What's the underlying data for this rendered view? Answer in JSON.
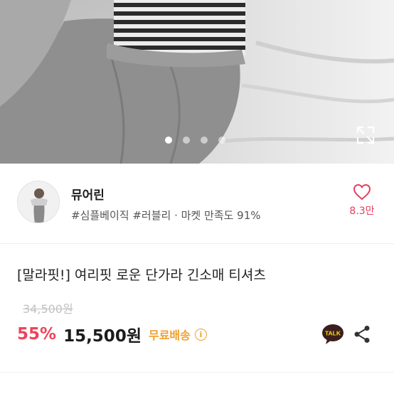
{
  "carousel": {
    "slide_count": 4,
    "active_index": 0
  },
  "shop": {
    "name": "뮤어린",
    "meta": "#심플베이직 #러블리 · 마켓 만족도 91%",
    "like_count": "8.3만"
  },
  "product": {
    "title": "[말라핏!] 여리핏 로운 단가라 긴소매 티셔츠",
    "original_price": "34,500원",
    "discount_rate": "55%",
    "price": "15,500원",
    "shipping_label": "무료배송",
    "info_icon_glyph": "i"
  },
  "icons": {
    "talk_label": "TALK",
    "expand": "expand-icon",
    "heart": "heart-icon",
    "share": "share-icon"
  },
  "colors": {
    "discount": "#f0435a",
    "like": "#e4405f",
    "shipping": "#f0a030",
    "talk_bg": "#3c1e1e",
    "talk_badge": "#f9e000"
  }
}
